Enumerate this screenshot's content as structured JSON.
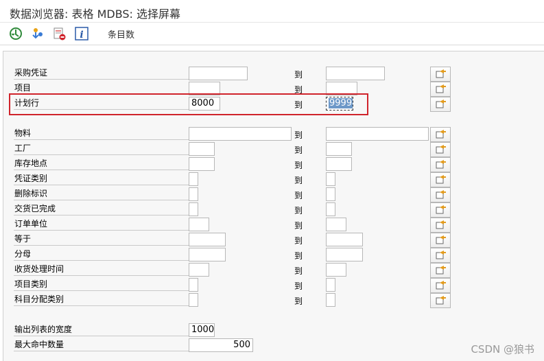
{
  "window": {
    "title": "数据浏览器: 表格 MDBS: 选择屏幕"
  },
  "toolbar": {
    "entries_label": "条目数"
  },
  "range_to_label": "到",
  "fields": [
    {
      "label": "采购凭证",
      "low": "",
      "high": ""
    },
    {
      "label": "项目",
      "low": "",
      "high": ""
    },
    {
      "label": "计划行",
      "low": "8000",
      "high": "9999"
    },
    {
      "label": "物料",
      "low": "",
      "high": ""
    },
    {
      "label": "工厂",
      "low": "",
      "high": ""
    },
    {
      "label": "库存地点",
      "low": "",
      "high": ""
    },
    {
      "label": "凭证类别",
      "low": "",
      "high": ""
    },
    {
      "label": "删除标识",
      "low": "",
      "high": ""
    },
    {
      "label": "交货已完成",
      "low": "",
      "high": ""
    },
    {
      "label": "订单单位",
      "low": "",
      "high": ""
    },
    {
      "label": "等于",
      "low": "",
      "high": ""
    },
    {
      "label": "分母",
      "low": "",
      "high": ""
    },
    {
      "label": "收货处理时间",
      "low": "",
      "high": ""
    },
    {
      "label": "项目类别",
      "low": "",
      "high": ""
    },
    {
      "label": "科目分配类别",
      "low": "",
      "high": ""
    }
  ],
  "settings": [
    {
      "label": "输出列表的宽度",
      "value": "1000"
    },
    {
      "label": "最大命中数量",
      "value": "500"
    }
  ],
  "watermark": "CSDN @狼书"
}
